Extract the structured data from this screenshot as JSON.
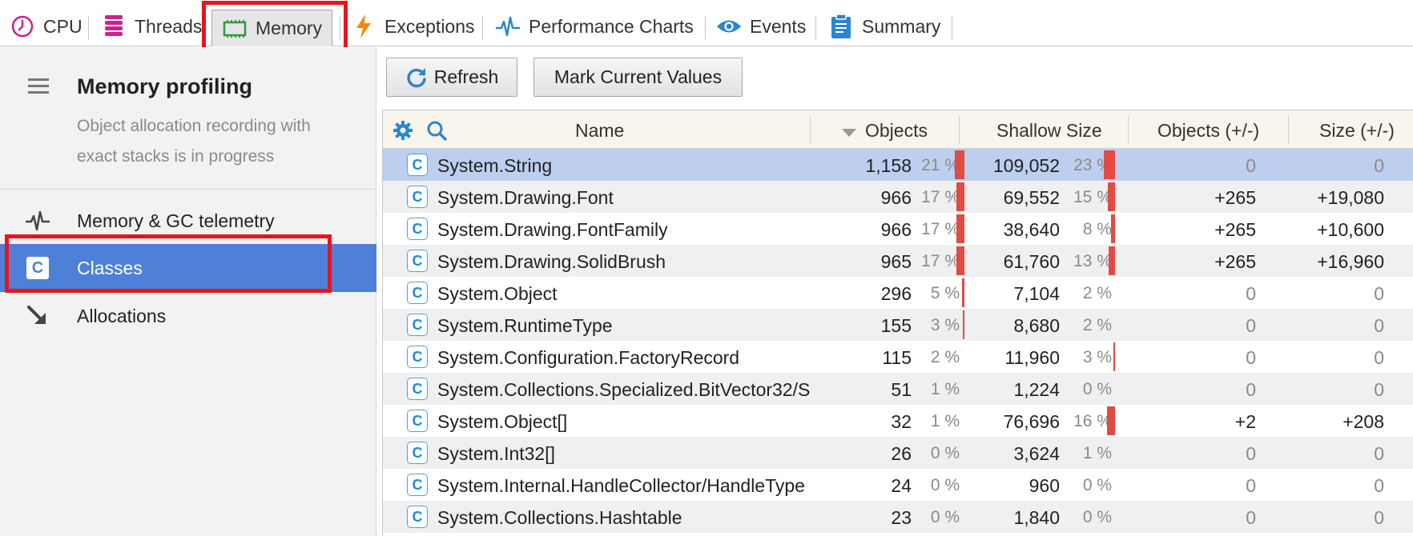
{
  "tabs": [
    {
      "label": "CPU",
      "icon": "clock-icon",
      "color": "#c8238e"
    },
    {
      "label": "Threads",
      "icon": "threads-stack-icon",
      "color": "#c8238e"
    },
    {
      "label": "Memory",
      "icon": "memory-chip-icon",
      "color": "#2e9b3e",
      "active": true
    },
    {
      "label": "Exceptions",
      "icon": "lightning-icon",
      "color": "#f08a12"
    },
    {
      "label": "Performance Charts",
      "icon": "pulse-chart-icon",
      "color": "#2b86cf"
    },
    {
      "label": "Events",
      "icon": "eye-icon",
      "color": "#2b86cf"
    },
    {
      "label": "Summary",
      "icon": "clipboard-icon",
      "color": "#2b86cf"
    }
  ],
  "sidebar": {
    "title": "Memory profiling",
    "subtitle_line1": "Object allocation recording with",
    "subtitle_line2": "exact stacks is in progress",
    "items": [
      {
        "label": "Memory & GC telemetry",
        "icon": "pulse-icon"
      },
      {
        "label": "Classes",
        "icon": "class-c-icon",
        "active": true
      },
      {
        "label": "Allocations",
        "icon": "arrow-down-right-icon"
      }
    ]
  },
  "toolbar": {
    "refresh_label": "Refresh",
    "mark_label": "Mark Current Values"
  },
  "table": {
    "columns": {
      "name": "Name",
      "objects": "Objects",
      "shallow_size": "Shallow Size",
      "objects_delta": "Objects (+/-)",
      "size_delta": "Size (+/-)"
    },
    "rows": [
      {
        "icon": "C",
        "name": "System.String",
        "objects": "1,158",
        "objects_pct": "21 %",
        "objects_frac": 0.21,
        "size": "109,052",
        "size_pct": "23 %",
        "size_frac": 0.23,
        "obj_delta": "0",
        "size_delta": "0"
      },
      {
        "icon": "C",
        "name": "System.Drawing.Font",
        "objects": "966",
        "objects_pct": "17 %",
        "objects_frac": 0.17,
        "size": "69,552",
        "size_pct": "15 %",
        "size_frac": 0.15,
        "obj_delta": "+265",
        "size_delta": "+19,080"
      },
      {
        "icon": "C",
        "name": "System.Drawing.FontFamily",
        "objects": "966",
        "objects_pct": "17 %",
        "objects_frac": 0.17,
        "size": "38,640",
        "size_pct": "8 %",
        "size_frac": 0.08,
        "obj_delta": "+265",
        "size_delta": "+10,600"
      },
      {
        "icon": "C",
        "name": "System.Drawing.SolidBrush",
        "objects": "965",
        "objects_pct": "17 %",
        "objects_frac": 0.17,
        "size": "61,760",
        "size_pct": "13 %",
        "size_frac": 0.13,
        "obj_delta": "+265",
        "size_delta": "+16,960"
      },
      {
        "icon": "C",
        "name": "System.Object",
        "objects": "296",
        "objects_pct": "5 %",
        "objects_frac": 0.05,
        "size": "7,104",
        "size_pct": "2 %",
        "size_frac": 0.0,
        "obj_delta": "0",
        "size_delta": "0"
      },
      {
        "icon": "C",
        "name": "System.RuntimeType",
        "objects": "155",
        "objects_pct": "3 %",
        "objects_frac": 0.03,
        "size": "8,680",
        "size_pct": "2 %",
        "size_frac": 0.0,
        "obj_delta": "0",
        "size_delta": "0"
      },
      {
        "icon": "C",
        "name": "System.Configuration.FactoryRecord",
        "objects": "115",
        "objects_pct": "2 %",
        "objects_frac": 0.0,
        "size": "11,960",
        "size_pct": "3 %",
        "size_frac": 0.03,
        "obj_delta": "0",
        "size_delta": "0"
      },
      {
        "icon": "C",
        "name": "System.Collections.Specialized.BitVector32/S",
        "objects": "51",
        "objects_pct": "1 %",
        "objects_frac": 0.0,
        "size": "1,224",
        "size_pct": "0 %",
        "size_frac": 0.0,
        "obj_delta": "0",
        "size_delta": "0"
      },
      {
        "icon": "C",
        "name": "System.Object[]",
        "objects": "32",
        "objects_pct": "1 %",
        "objects_frac": 0.0,
        "size": "76,696",
        "size_pct": "16 %",
        "size_frac": 0.16,
        "obj_delta": "+2",
        "size_delta": "+208"
      },
      {
        "icon": "C",
        "name": "System.Int32[]",
        "objects": "26",
        "objects_pct": "0 %",
        "objects_frac": 0.0,
        "size": "3,624",
        "size_pct": "1 %",
        "size_frac": 0.0,
        "obj_delta": "0",
        "size_delta": "0"
      },
      {
        "icon": "C",
        "name": "System.Internal.HandleCollector/HandleType",
        "objects": "24",
        "objects_pct": "0 %",
        "objects_frac": 0.0,
        "size": "960",
        "size_pct": "0 %",
        "size_frac": 0.0,
        "obj_delta": "0",
        "size_delta": "0"
      },
      {
        "icon": "C",
        "name": "System.Collections.Hashtable",
        "objects": "23",
        "objects_pct": "0 %",
        "objects_frac": 0.0,
        "size": "1,840",
        "size_pct": "0 %",
        "size_frac": 0.0,
        "obj_delta": "0",
        "size_delta": "0"
      }
    ]
  },
  "colors": {
    "accent": "#4f80d8",
    "selected_row": "#bccfee",
    "bar": "#e34a42",
    "highlight_box": "#e8141b"
  }
}
